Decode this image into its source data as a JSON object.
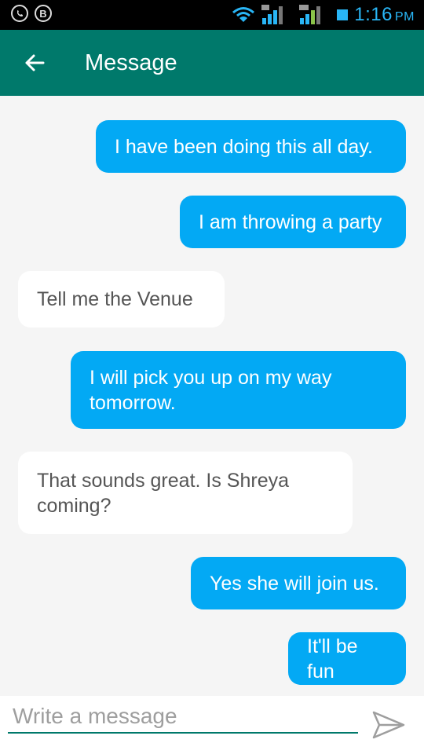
{
  "status_bar": {
    "time": "1:16",
    "ampm": "PM",
    "left_icons": [
      "whatsapp-icon",
      "b-icon"
    ],
    "b_label": "B",
    "accent_color": "#29b6f6"
  },
  "app_bar": {
    "title": "Message",
    "color": "#00796b"
  },
  "messages": [
    {
      "direction": "sent",
      "text": "I have been doing this all day."
    },
    {
      "direction": "sent",
      "text": "I am throwing a party"
    },
    {
      "direction": "received",
      "text": "Tell me the Venue"
    },
    {
      "direction": "sent",
      "text": "I will pick you up on my way tomorrow."
    },
    {
      "direction": "received",
      "text": "That sounds great. Is Shreya coming?"
    },
    {
      "direction": "sent",
      "text": "Yes she will join us."
    },
    {
      "direction": "sent",
      "text": "It'll be fun"
    }
  ],
  "colors": {
    "sent_bubble": "#03a9f4",
    "received_bubble": "#ffffff",
    "background": "#f5f5f5"
  },
  "input": {
    "placeholder": "Write a message",
    "value": ""
  }
}
